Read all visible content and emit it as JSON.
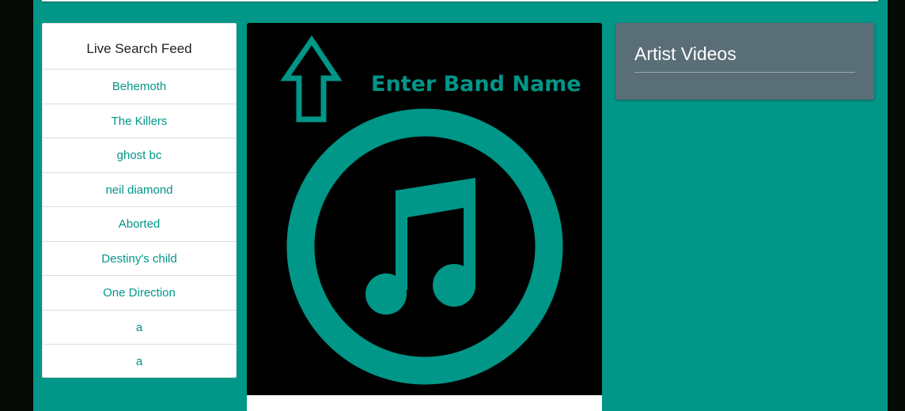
{
  "feed": {
    "title": "Live Search Feed",
    "items": [
      {
        "label": "Behemoth"
      },
      {
        "label": "The Killers"
      },
      {
        "label": "ghost bc"
      },
      {
        "label": "neil diamond"
      },
      {
        "label": "Aborted"
      },
      {
        "label": "Destiny's child"
      },
      {
        "label": "One Direction"
      },
      {
        "label": "a"
      },
      {
        "label": "a"
      }
    ]
  },
  "hero": {
    "prompt": "Enter Band Name",
    "arrow_icon": "arrow-up-icon",
    "music_icon": "music-note-icon"
  },
  "videos": {
    "title": "Artist Videos"
  },
  "colors": {
    "accent": "#009688",
    "panel": "#5a6e78",
    "background": "#050a07"
  }
}
